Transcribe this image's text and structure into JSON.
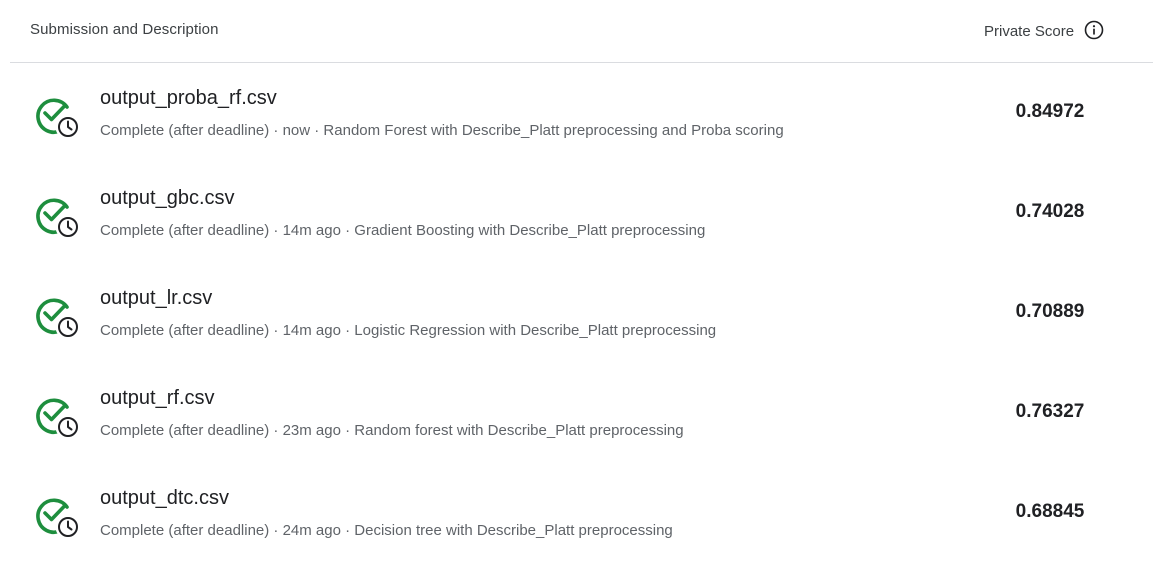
{
  "header": {
    "left_label": "Submission and Description",
    "right_label": "Private Score",
    "info_icon": "info-icon"
  },
  "colors": {
    "check_green": "#1e8e3e",
    "clock_dark": "#3c4043",
    "text_primary": "#202124",
    "text_secondary": "#5f6368",
    "divider": "#dadce0"
  },
  "submissions": [
    {
      "file_name": "output_proba_rf.csv",
      "description": "Complete (after deadline) · now · Random Forest with Describe_Platt preprocessing and Proba scoring",
      "score": "0.84972",
      "status_icon": "check-clock-icon"
    },
    {
      "file_name": "output_gbc.csv",
      "description": "Complete (after deadline) · 14m ago · Gradient Boosting with Describe_Platt preprocessing",
      "score": "0.74028",
      "status_icon": "check-clock-icon"
    },
    {
      "file_name": "output_lr.csv",
      "description": "Complete (after deadline) · 14m ago · Logistic Regression with Describe_Platt preprocessing",
      "score": "0.70889",
      "status_icon": "check-clock-icon"
    },
    {
      "file_name": "output_rf.csv",
      "description": "Complete (after deadline) · 23m ago · Random forest with Describe_Platt preprocessing",
      "score": "0.76327",
      "status_icon": "check-clock-icon"
    },
    {
      "file_name": "output_dtc.csv",
      "description": "Complete (after deadline) · 24m ago · Decision tree with Describe_Platt preprocessing",
      "score": "0.68845",
      "status_icon": "check-clock-icon"
    }
  ]
}
